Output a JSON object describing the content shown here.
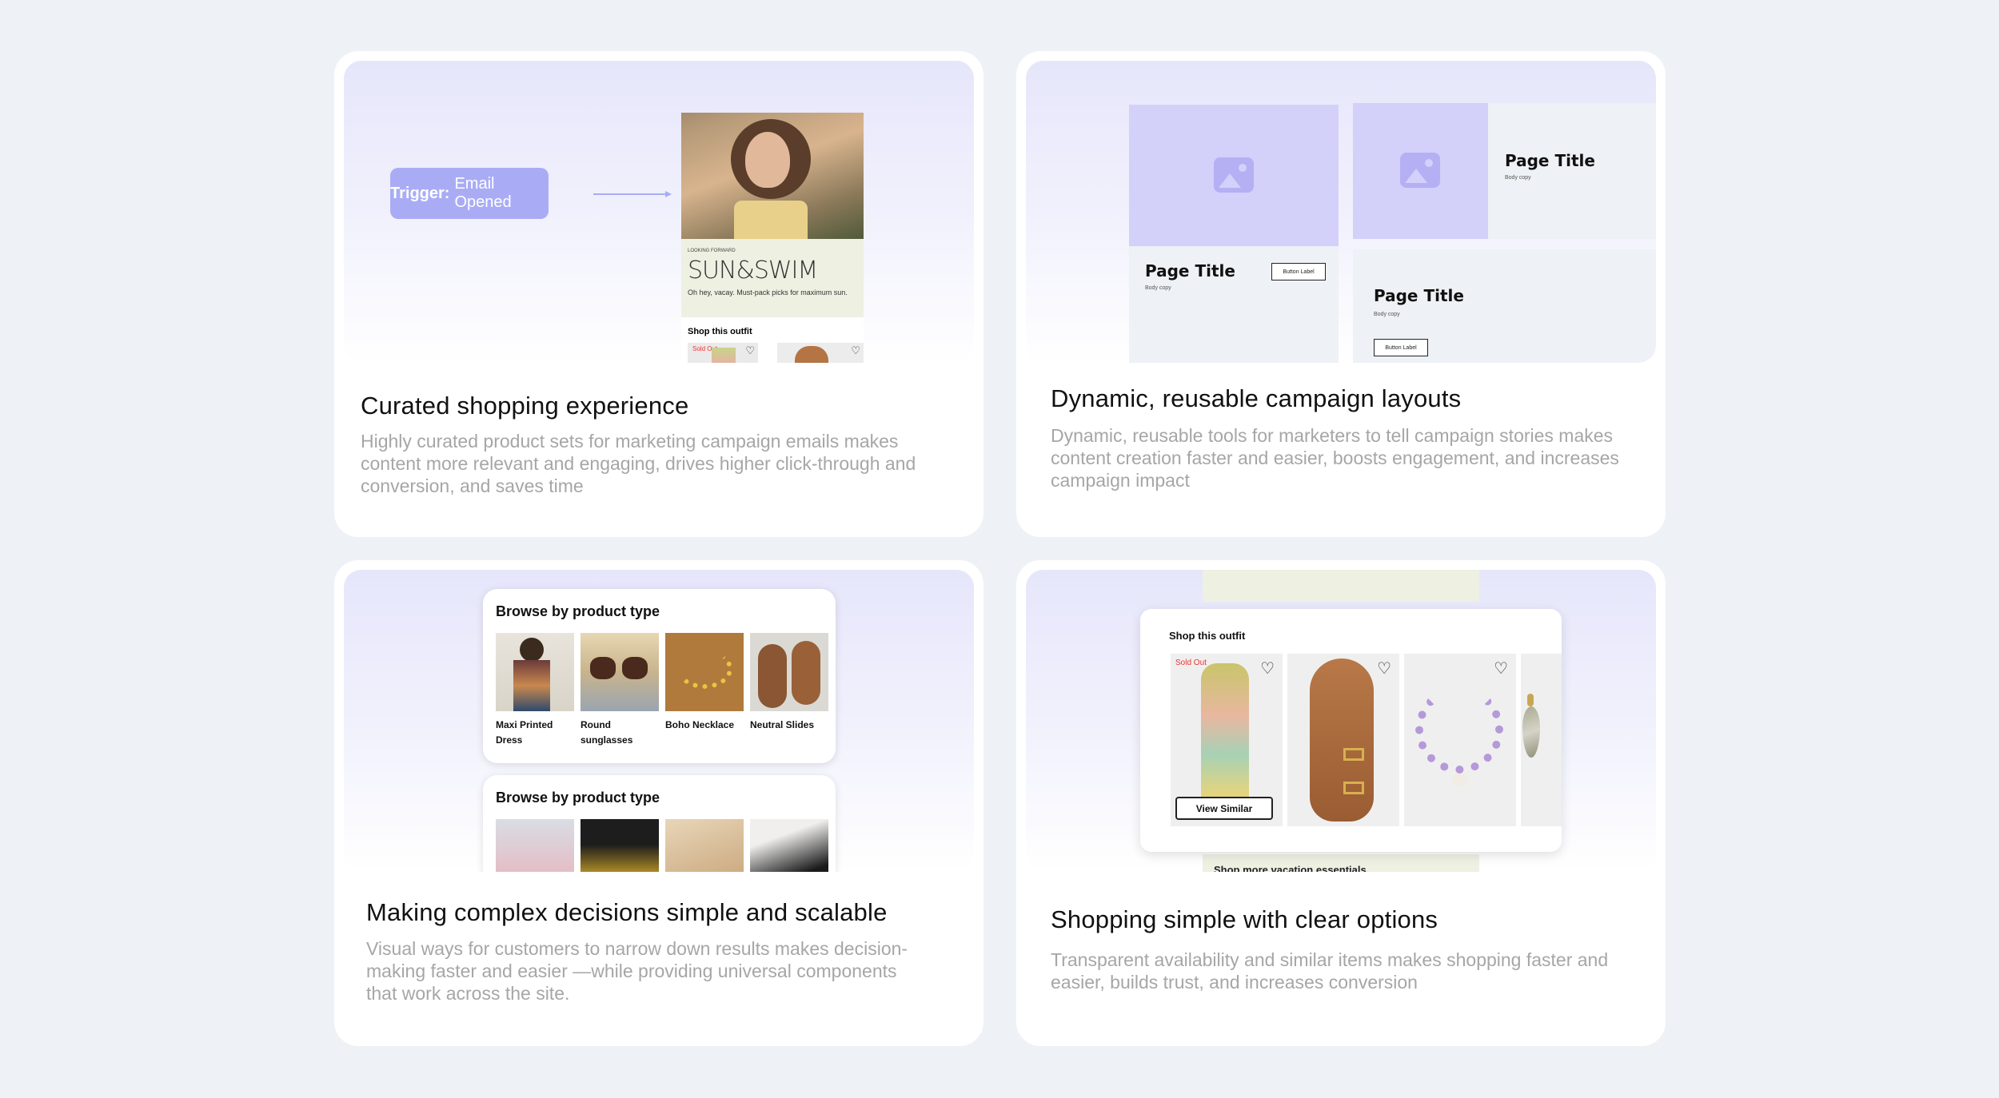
{
  "cards": [
    {
      "title": "Curated shopping experience",
      "description": "Highly curated product sets for marketing campaign emails makes content more relevant and engaging, drives higher click-through and conversion, and saves time",
      "trigger": {
        "label": "Trigger:",
        "value": "Email Opened"
      },
      "phone": {
        "tiny_caption": "LOOKING FORWARD",
        "brand": "SUN&SWIM",
        "tagline": "Oh hey, vacay. Must-pack picks for maximum sun.",
        "shop_label": "Shop this outfit",
        "sold_out": "Sold Out"
      }
    },
    {
      "title": "Dynamic, reusable campaign layouts",
      "description": "Dynamic, reusable tools for marketers to tell campaign stories makes content creation faster and easier, boosts engagement, and increases campaign impact",
      "tiles": [
        {
          "title": "Page Title",
          "body": "Body copy",
          "button": "Button Label"
        },
        {
          "title": "Page Title",
          "body": "Body copy"
        },
        {
          "title": "Page Title",
          "body": "Body copy",
          "button": "Button Label"
        }
      ]
    },
    {
      "title": "Making complex decisions simple and scalable",
      "description": "Visual ways for customers to narrow down results makes decision-making faster and easier —while providing universal components that work across the site.",
      "browse_heading_1": "Browse by product type",
      "browse_heading_2": "Browse by product type",
      "products": [
        {
          "label": "Maxi Printed Dress"
        },
        {
          "label": "Round sunglasses"
        },
        {
          "label": "Boho Necklace"
        },
        {
          "label": "Neutral Slides"
        }
      ]
    },
    {
      "title": "Shopping simple with clear options",
      "description": "Transparent availability and similar items makes shopping faster and easier, builds trust, and increases conversion",
      "shop_label": "Shop this outfit",
      "sold_out": "Sold Out",
      "view_similar": "View Similar",
      "bottom_strip": "Shop more vacation essentials"
    }
  ],
  "colors": {
    "background": "#eef1f5",
    "accent": "#a9acf5",
    "placeholder": "#d3d0fa",
    "text_muted": "#a6a6a6"
  }
}
